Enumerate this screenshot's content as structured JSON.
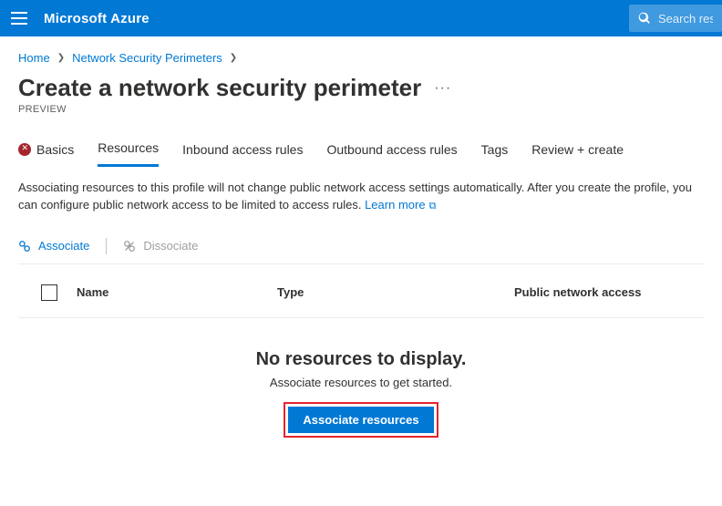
{
  "topbar": {
    "brand": "Microsoft Azure",
    "search_placeholder": "Search reso"
  },
  "breadcrumb": {
    "home": "Home",
    "section": "Network Security Perimeters"
  },
  "page": {
    "title": "Create a network security perimeter",
    "preview_label": "PREVIEW"
  },
  "tabs": {
    "basics": "Basics",
    "resources": "Resources",
    "inbound": "Inbound access rules",
    "outbound": "Outbound access rules",
    "tags": "Tags",
    "review": "Review + create"
  },
  "description": {
    "text": "Associating resources to this profile will not change public network access settings automatically. After you create the profile, you can configure public network access to be limited to access rules. ",
    "learn_more": "Learn more"
  },
  "toolbar": {
    "associate": "Associate",
    "dissociate": "Dissociate"
  },
  "table": {
    "col_name": "Name",
    "col_type": "Type",
    "col_access": "Public network access"
  },
  "empty": {
    "title": "No resources to display.",
    "subtitle": "Associate resources to get started.",
    "button": "Associate resources"
  }
}
